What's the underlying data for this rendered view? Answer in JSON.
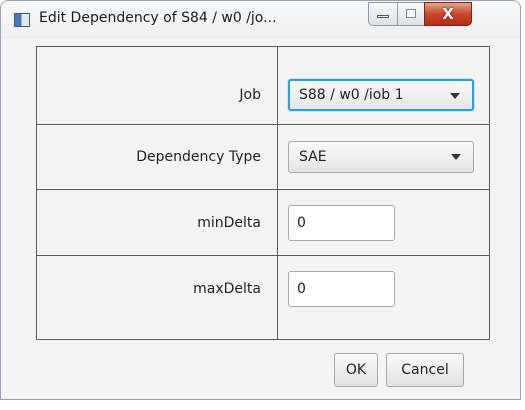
{
  "window": {
    "title": "Edit Dependency of S84 / w0 /jo...",
    "close_glyph": "X"
  },
  "form": {
    "rows": [
      {
        "label": "Job",
        "value": "S88 / w0 /iob 1"
      },
      {
        "label": "Dependency Type",
        "value": "SAE"
      },
      {
        "label": "minDelta",
        "value": "0"
      },
      {
        "label": "maxDelta",
        "value": "0"
      }
    ]
  },
  "buttons": {
    "ok": "OK",
    "cancel": "Cancel"
  },
  "colors": {
    "focus_accent": "#2da0d8",
    "close_button": "#c8452b"
  }
}
